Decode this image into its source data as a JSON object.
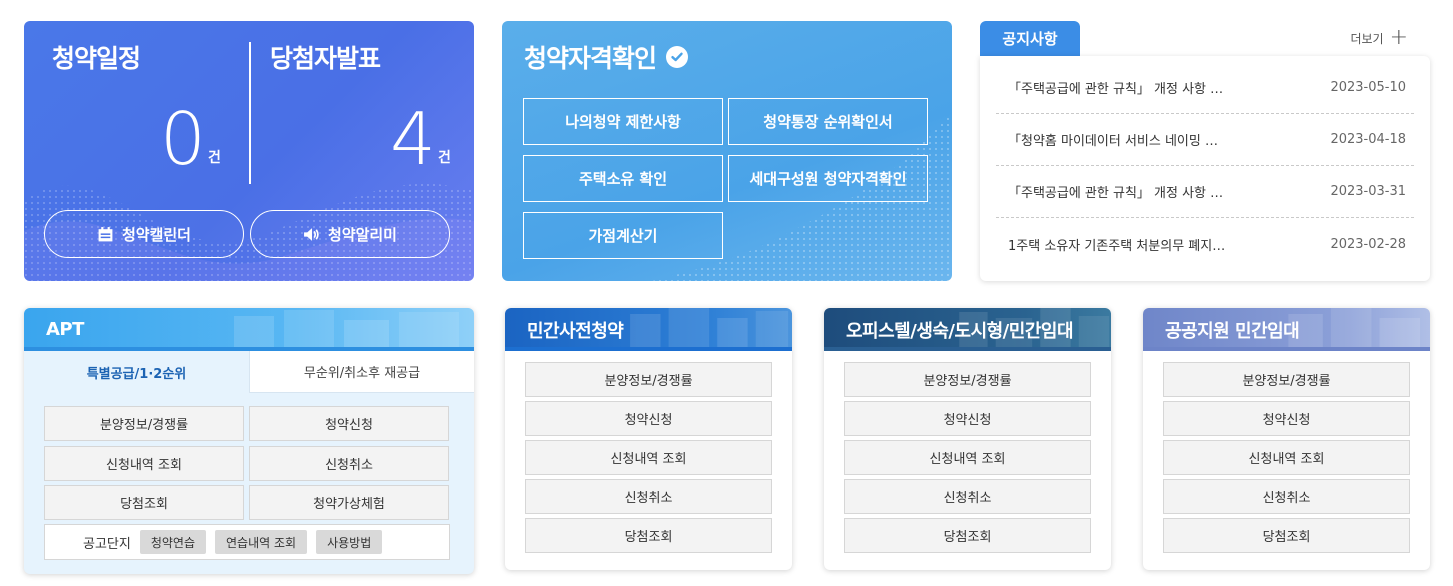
{
  "schedule": {
    "left_title": "청약일정",
    "left_count": "0",
    "right_title": "당첨자발표",
    "right_count": "4",
    "unit": "건",
    "calendar_button": "청약캘린더",
    "alarm_button": "청약알리미"
  },
  "eligibility": {
    "title": "청약자격확인",
    "buttons": [
      "나의청약 제한사항",
      "청약통장 순위확인서",
      "주택소유 확인",
      "세대구성원 청약자격확인",
      "가점계산기"
    ]
  },
  "notice": {
    "tab": "공지사항",
    "more": "더보기",
    "items": [
      {
        "title": "「주택공급에 관한 규칙」 개정 사항 …",
        "date": "2023-05-10"
      },
      {
        "title": "「청약홈 마이데이터 서비스 네이밍 …",
        "date": "2023-04-18"
      },
      {
        "title": "「주택공급에 관한 규칙」 개정 사항 …",
        "date": "2023-03-31"
      },
      {
        "title": "1주택 소유자 기존주택 처분의무 폐지…",
        "date": "2023-02-28"
      }
    ]
  },
  "apt": {
    "title": "APT",
    "tabs": [
      "특별공급/1·2순위",
      "무순위/취소후 재공급"
    ],
    "buttons": [
      "분양정보/경쟁률",
      "청약신청",
      "신청내역 조회",
      "신청취소",
      "당첨조회",
      "청약가상체험"
    ],
    "practice_label": "공고단지",
    "practice_chips": [
      "청약연습",
      "연습내역 조회",
      "사용방법"
    ]
  },
  "cards": [
    {
      "title": "민간사전청약",
      "buttons": [
        "분양정보/경쟁률",
        "청약신청",
        "신청내역 조회",
        "신청취소",
        "당첨조회"
      ]
    },
    {
      "title": "오피스텔/생숙/도시형/민간임대",
      "buttons": [
        "분양정보/경쟁률",
        "청약신청",
        "신청내역 조회",
        "신청취소",
        "당첨조회"
      ]
    },
    {
      "title": "공공지원 민간임대",
      "buttons": [
        "분양정보/경쟁률",
        "청약신청",
        "신청내역 조회",
        "신청취소",
        "당첨조회"
      ]
    }
  ]
}
